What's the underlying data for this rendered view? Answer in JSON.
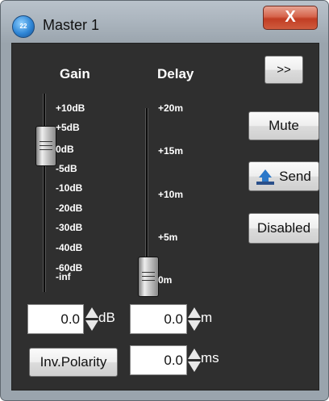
{
  "window": {
    "title": "Master 1",
    "close_label": "X",
    "app_icon_label": "22"
  },
  "gain": {
    "header": "Gain",
    "ticks": [
      "+10dB",
      "+5dB",
      "0dB",
      "-5dB",
      "-10dB",
      "-20dB",
      "-30dB",
      "-40dB",
      "-60dB",
      "-inf"
    ],
    "value": "0.0",
    "unit": "dB"
  },
  "delay": {
    "header": "Delay",
    "ticks": [
      "+20m",
      "+15m",
      "+10m",
      "+5m",
      "0m"
    ],
    "value": "0.0",
    "unit": "m",
    "ms_value": "0.0",
    "ms_unit": "ms"
  },
  "buttons": {
    "expand": ">>",
    "mute": "Mute",
    "send": "Send",
    "disabled": "Disabled",
    "inv_polarity": "Inv.Polarity"
  }
}
